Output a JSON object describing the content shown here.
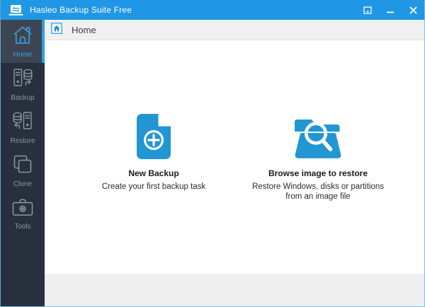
{
  "window": {
    "title": "Hasleo Backup Suite Free",
    "controls": {
      "tray": "minimize-to-tray",
      "minimize": "minimize",
      "close": "close"
    }
  },
  "colors": {
    "titlebar_blue": "#1f97e4",
    "sidebar_dark": "#28303e",
    "sidebar_selected_bg": "#3e4552",
    "accent_blue": "#2e9fe0",
    "action_icon_blue": "#2196d3",
    "header_bg": "#f0f0f0",
    "footer_bg": "#efefef"
  },
  "sidebar": {
    "items": [
      {
        "label": "Home",
        "icon": "home-icon",
        "selected": true
      },
      {
        "label": "Backup",
        "icon": "backup-icon",
        "selected": false
      },
      {
        "label": "Restore",
        "icon": "restore-icon",
        "selected": false
      },
      {
        "label": "Clone",
        "icon": "clone-icon",
        "selected": false
      },
      {
        "label": "Tools",
        "icon": "tools-icon",
        "selected": false
      }
    ]
  },
  "header": {
    "tab_label": "Home",
    "tab_icon": "home-tab-icon"
  },
  "main": {
    "actions": [
      {
        "icon": "new-backup-document-icon",
        "title": "New Backup",
        "subtitle": "Create your first backup task"
      },
      {
        "icon": "browse-image-folder-search-icon",
        "title": "Browse image to restore",
        "subtitle": "Restore Windows, disks or partitions from an image file"
      }
    ]
  }
}
